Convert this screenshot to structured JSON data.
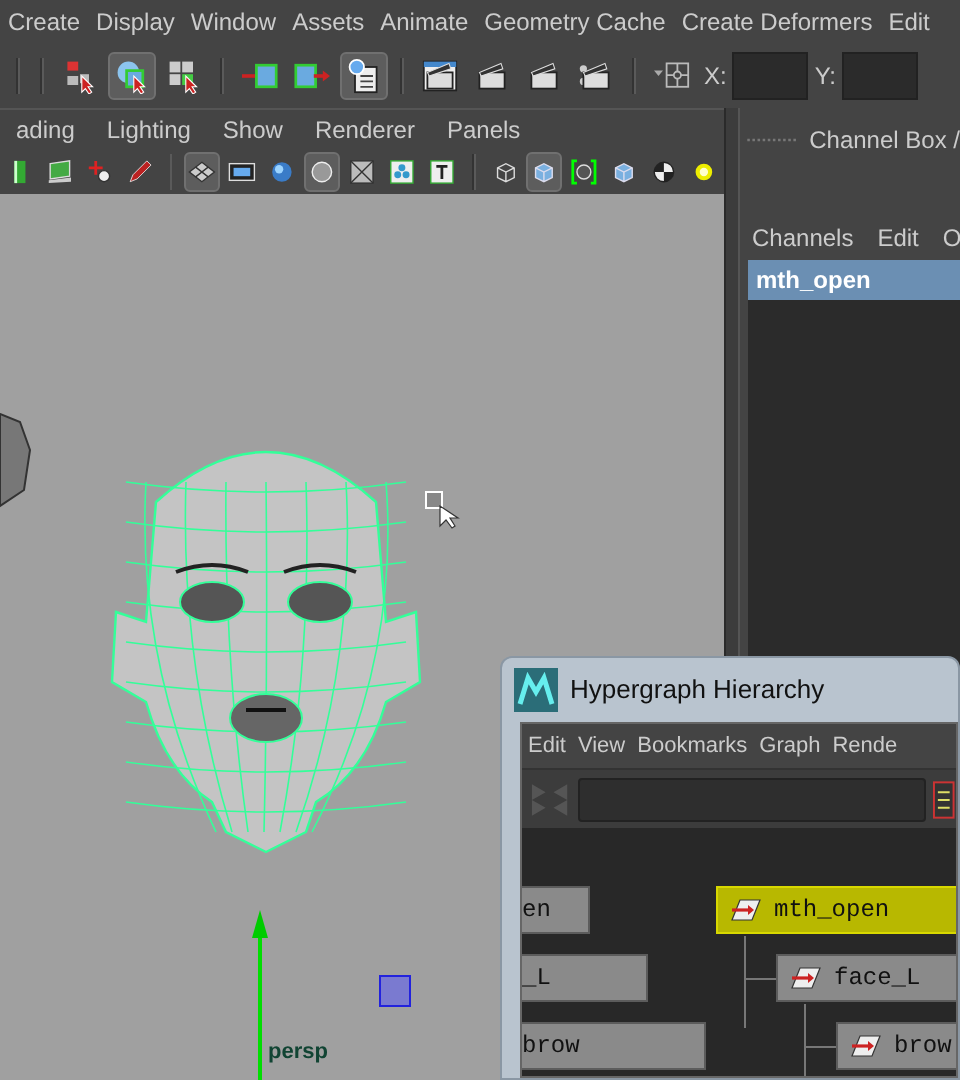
{
  "menu_bar": [
    "Create",
    "Display",
    "Window",
    "Assets",
    "Animate",
    "Geometry Cache",
    "Create Deformers",
    "Edit"
  ],
  "toolbar": {
    "tools": [
      {
        "kind": "select-hierarchy",
        "pressed": false
      },
      {
        "kind": "select-object",
        "pressed": true
      },
      {
        "kind": "select-component",
        "pressed": false
      },
      {
        "kind": "input-ops",
        "pressed": false
      },
      {
        "kind": "output-ops",
        "pressed": false
      },
      {
        "kind": "history",
        "pressed": true
      },
      {
        "kind": "render-view",
        "pressed": false
      },
      {
        "kind": "render",
        "pressed": false
      },
      {
        "kind": "ipr-render",
        "pressed": false
      },
      {
        "kind": "render-settings",
        "pressed": false
      },
      {
        "kind": "snap",
        "pressed": false
      }
    ],
    "coord_fields": [
      {
        "label": "X:"
      },
      {
        "label": "Y:"
      }
    ]
  },
  "viewport": {
    "menu": [
      "ading",
      "Lighting",
      "Show",
      "Renderer",
      "Panels"
    ],
    "tools": [
      {
        "kind": "camera",
        "pressed": false
      },
      {
        "kind": "image-plane",
        "pressed": false
      },
      {
        "kind": "bookmark",
        "pressed": false
      },
      {
        "kind": "pencil",
        "pressed": false
      },
      {
        "kind": "grid",
        "pressed": true
      },
      {
        "kind": "film",
        "pressed": false
      },
      {
        "kind": "sphere",
        "pressed": false
      },
      {
        "kind": "circle",
        "pressed": true
      },
      {
        "kind": "mesh",
        "pressed": false
      },
      {
        "kind": "nodes",
        "pressed": false
      },
      {
        "kind": "text",
        "pressed": false
      },
      {
        "kind": "wireframe",
        "pressed": false
      },
      {
        "kind": "shaded",
        "pressed": true
      },
      {
        "kind": "isolate",
        "pressed": false
      },
      {
        "kind": "cube",
        "pressed": false
      },
      {
        "kind": "checker",
        "pressed": false
      },
      {
        "kind": "light",
        "pressed": false
      }
    ],
    "camera_label": "persp"
  },
  "channel_box": {
    "title": "Channel Box /",
    "menu": [
      "Channels",
      "Edit",
      "O"
    ],
    "items": [
      {
        "label": "mth_open",
        "selected": true
      }
    ]
  },
  "hypergraph": {
    "title": "Hypergraph Hierarchy",
    "menu": [
      "Edit",
      "View",
      "Bookmarks",
      "Graph",
      "Rende"
    ],
    "left_nodes": [
      {
        "label": "en",
        "selected": false
      },
      {
        "label": "_L",
        "selected": false
      },
      {
        "label": "brow",
        "selected": false
      }
    ],
    "tree": [
      {
        "label": "mth_open",
        "selected": true,
        "children": [
          {
            "label": "face_L",
            "selected": false,
            "children": [
              {
                "label": "brow",
                "selected": false
              }
            ]
          }
        ]
      }
    ]
  }
}
